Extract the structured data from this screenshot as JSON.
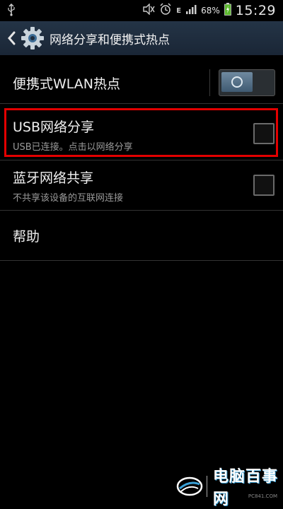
{
  "status_bar": {
    "usb_icon": "usb-icon",
    "battery_percent": "68%",
    "network_type": "E",
    "time": "15:29"
  },
  "app_bar": {
    "title": "网络分享和便携式热点"
  },
  "settings": [
    {
      "id": "wlan",
      "label": "便携式WLAN热点",
      "control": "toggle",
      "state": "off"
    },
    {
      "id": "usb",
      "label": "USB网络分享",
      "summary": "USB已连接。点击以网络分享",
      "control": "checkbox",
      "checked": false,
      "highlighted": true
    },
    {
      "id": "bluetooth",
      "label": "蓝牙网络共享",
      "summary": "不共享该设备的互联网连接",
      "control": "checkbox",
      "checked": false
    },
    {
      "id": "help",
      "label": "帮助"
    }
  ],
  "colors": {
    "background": "#000000",
    "app_bar": "#1f2d3d",
    "highlight": "#e30000",
    "secondary_text": "#9a9a9a"
  },
  "watermark": {
    "text": "电脑百事网",
    "url": "PC841.COM"
  }
}
